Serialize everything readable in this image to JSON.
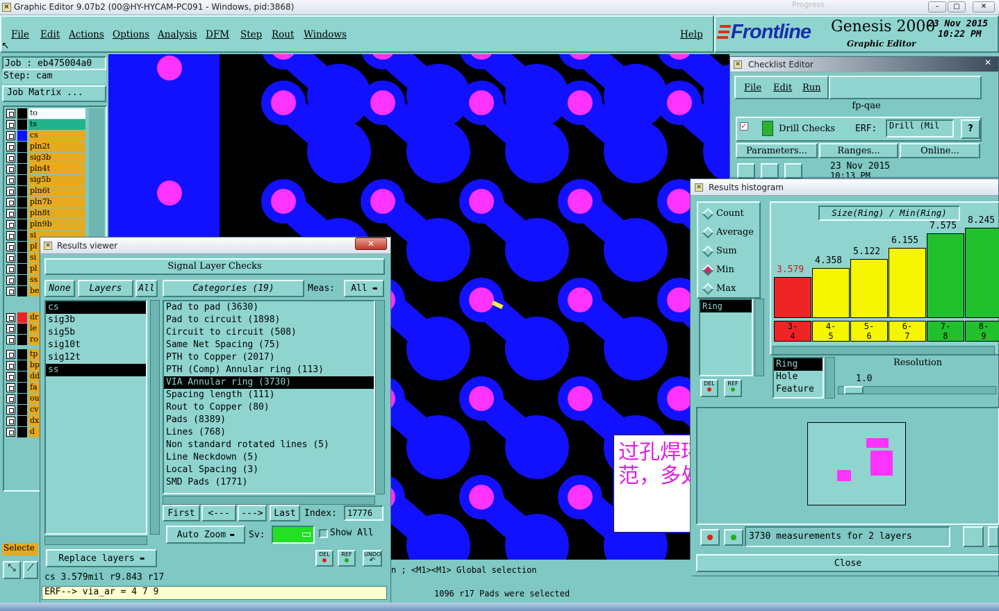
{
  "window": {
    "title": "Graphic Editor 9.07b2 (00@HY-HYCAM-PC091 - Windows, pid:3868)",
    "min": "–",
    "max": "▢",
    "close": "✕",
    "ghost": "Progress"
  },
  "menu": {
    "items": [
      "File",
      "Edit",
      "Actions",
      "Options",
      "Analysis",
      "DFM",
      "Step",
      "Rout",
      "Windows"
    ],
    "help": "Help"
  },
  "brand": {
    "logo": "Frontline",
    "product": "Genesis 2000",
    "subtitle": "Graphic Editor",
    "date": "23 Nov 2015",
    "time": "10:22 PM"
  },
  "left": {
    "job": "Job : eb475004a0",
    "step": "Step: cam",
    "job_matrix": "Job Matrix ...",
    "layers": [
      "to",
      "ts",
      "cs",
      "pln2t",
      "sig3b",
      "pln4t",
      "sig5b",
      "pln6t",
      "pln7b",
      "pln8t",
      "pln9b",
      "si",
      "pl",
      "si",
      "pl",
      "ss",
      "be"
    ],
    "layers2": [
      "dr",
      "le",
      "ro"
    ],
    "layers3": [
      "tp",
      "bp",
      "dd",
      "fa",
      "ou",
      "cv",
      "dx",
      "d"
    ],
    "selected_label": "Selecte"
  },
  "results_viewer": {
    "title": "Results viewer",
    "close": "✕",
    "header": "Signal Layer Checks",
    "none_btn": "None",
    "layers_btn": "Layers",
    "all_btn": "All",
    "categories_btn": "Categories (19)",
    "meas_label": "Meas:",
    "meas_value": "All",
    "layer_list": [
      "cs",
      "sig3b",
      "sig5b",
      "sig10t",
      "sig12t",
      "ss"
    ],
    "categories": [
      "Pad to pad (3630)",
      "Pad to circuit (1898)",
      "Circuit to circuit (508)",
      "Same Net Spacing (75)",
      "PTH to Copper (2017)",
      "PTH (Comp) Annular ring (113)",
      "VIA Annular ring (3730)",
      "Spacing length (111)",
      "Rout to Copper (80)",
      "Pads (8389)",
      "Lines (768)",
      "Non standard rotated lines (5)",
      "Line Neckdown (5)",
      "Local Spacing (3)",
      "SMD Pads (1771)"
    ],
    "first_btn": "First",
    "prev_btn": "<---",
    "next_btn": "--->",
    "last_btn": "Last",
    "index_label": "Index:",
    "index_value": "17776",
    "auto_zoom": "Auto Zoom",
    "sv_label": "Sv:",
    "show_all": "Show All",
    "replace_layers": "Replace layers",
    "del": "DEL",
    "ref": "REF",
    "undo": "UNDO",
    "measure_line": "cs 3.579mil   r9.843  r17",
    "erf_line": "ERF--> via_ar = 4 7 9"
  },
  "checklist": {
    "title": "Checklist Editor",
    "menu": [
      "File",
      "Edit",
      "Run"
    ],
    "name": "fp-qae",
    "check_name": "Drill Checks",
    "erf_label": "ERF:",
    "erf_value": "Drill (Mil",
    "help": "?",
    "params": "Parameters...",
    "ranges": "Ranges...",
    "online": "Online...",
    "date": "23 Nov 2015",
    "time": "10:13 PM"
  },
  "histogram": {
    "title": "Results histogram",
    "modes": [
      "Count",
      "Average",
      "Sum",
      "Min",
      "Max"
    ],
    "selected_mode": "Min",
    "graph_title": "Size(Ring) / Min(Ring)",
    "ring_label": "Ring",
    "bars": [
      {
        "value": "3.579",
        "range": "3- 4",
        "level": 0.45,
        "color": "#ef2424"
      },
      {
        "value": "4.358",
        "range": "4- 5",
        "level": 0.55,
        "color": "#f6f600"
      },
      {
        "value": "5.122",
        "range": "5- 6",
        "level": 0.65,
        "color": "#f6f600"
      },
      {
        "value": "6.155",
        "range": "6- 7",
        "level": 0.78,
        "color": "#f6f600"
      },
      {
        "value": "7.575",
        "range": "7- 8",
        "level": 0.94,
        "color": "#21c12e"
      },
      {
        "value": "8.245",
        "range": "8- 9",
        "level": 1.0,
        "color": "#21c12e"
      }
    ],
    "attr_list": [
      "Ring",
      "Hole",
      "Feature"
    ],
    "resolution_label": "Resolution",
    "resolution_value": "1.0",
    "del": "DEL",
    "ref": "REF",
    "measurements": "3730 measurements for 2 layers",
    "close": "Close"
  },
  "status": {
    "line1": "n ; <M1><M1> Global selection",
    "line2": "1096 r17 Pads were selected"
  },
  "annotation": {
    "text": "过孔焊环不满足规范，多处"
  }
}
